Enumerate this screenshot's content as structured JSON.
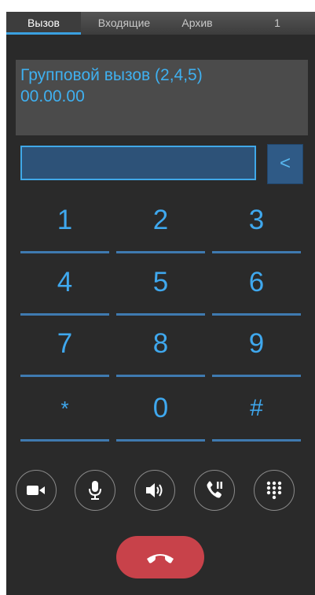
{
  "tabs": [
    {
      "label": "Вызов",
      "active": true
    },
    {
      "label": "Входящие",
      "active": false
    },
    {
      "label": "Архив",
      "active": false
    },
    {
      "label": "1",
      "active": false
    }
  ],
  "call": {
    "title": "Групповой вызов (2,4,5)",
    "timer": "00.00.00"
  },
  "dial_input": {
    "value": "",
    "placeholder": ""
  },
  "backspace_label": "<",
  "keypad": [
    "1",
    "2",
    "3",
    "4",
    "5",
    "6",
    "7",
    "8",
    "9",
    "*",
    "0",
    "#"
  ],
  "actions": [
    {
      "name": "video-camera-icon"
    },
    {
      "name": "microphone-icon"
    },
    {
      "name": "speaker-icon"
    },
    {
      "name": "call-hold-icon"
    },
    {
      "name": "dialpad-icon"
    }
  ],
  "hangup_icon": "phone-hangup-icon",
  "colors": {
    "accent": "#3fa8ee",
    "hangup": "#c8424a",
    "background": "#2a2a2a"
  }
}
